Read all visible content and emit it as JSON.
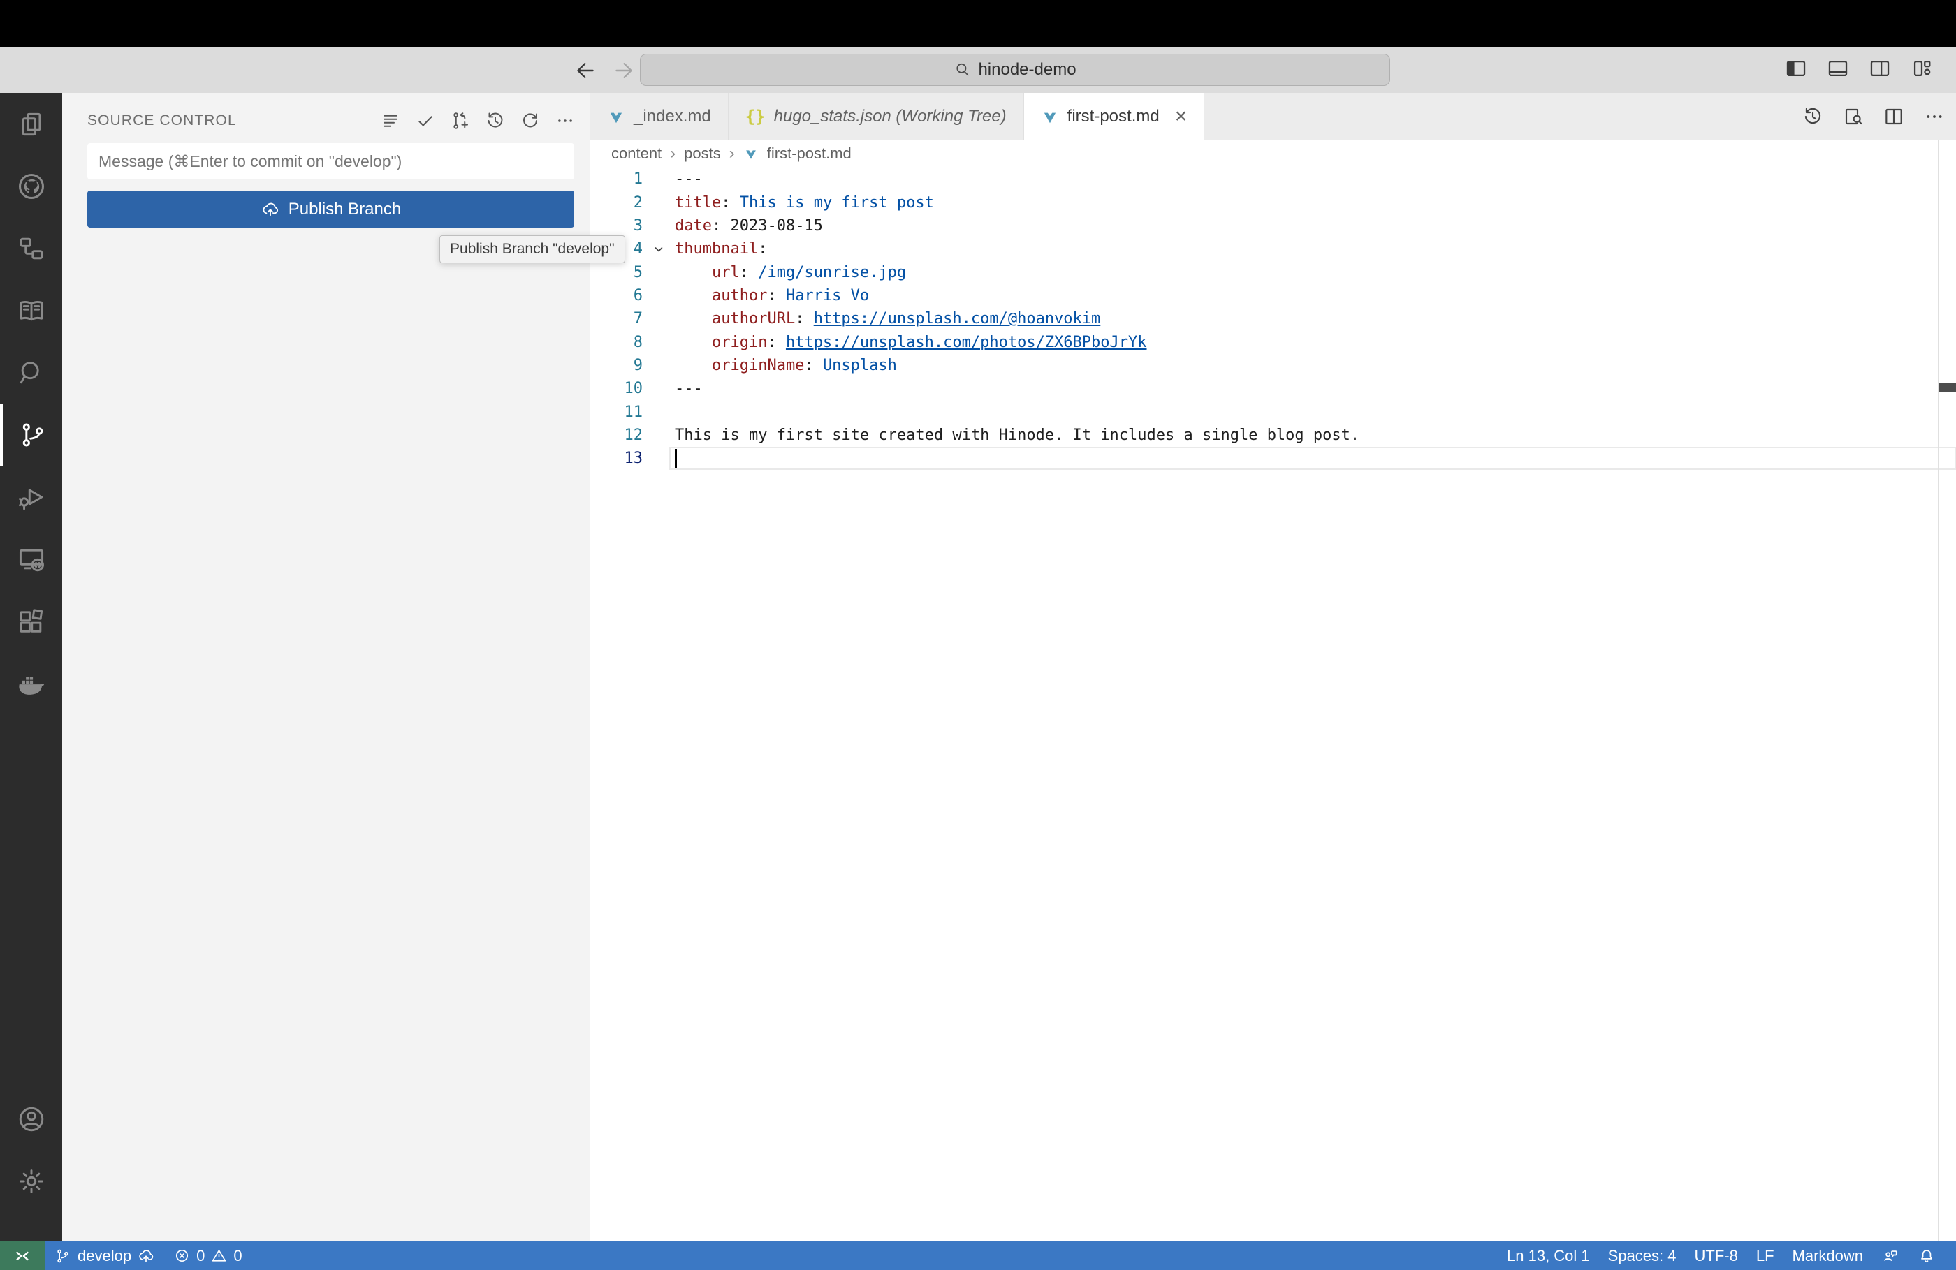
{
  "title_bar": {
    "search_value": "hinode-demo"
  },
  "source_control": {
    "header": "SOURCE CONTROL",
    "message_placeholder": "Message (⌘Enter to commit on \"develop\")",
    "publish_label": "Publish Branch",
    "tooltip": "Publish Branch \"develop\""
  },
  "tabs": {
    "tab1": "_index.md",
    "tab2": "hugo_stats.json (Working Tree)",
    "tab3": "first-post.md",
    "close_glyph": "×",
    "json_glyph": "{}"
  },
  "breadcrumbs": {
    "item1": "content",
    "item2": "posts",
    "item3": "first-post.md",
    "sep": "›"
  },
  "editor": {
    "lines": [
      {
        "num": "1",
        "tokens": [
          {
            "t": "---"
          }
        ]
      },
      {
        "num": "2",
        "tokens": [
          {
            "t": "title"
          },
          {
            "t": ": "
          },
          {
            "t": "This is my first post"
          }
        ]
      },
      {
        "num": "3",
        "tokens": [
          {
            "t": "date"
          },
          {
            "t": ": 2023-08-15"
          }
        ]
      },
      {
        "num": "4",
        "tokens": [
          {
            "t": "thumbnail"
          },
          {
            "t": ":"
          }
        ]
      },
      {
        "num": "5",
        "tokens": [
          {
            "t": "    url"
          },
          {
            "t": ": "
          },
          {
            "t": "/img/sunrise.jpg"
          }
        ]
      },
      {
        "num": "6",
        "tokens": [
          {
            "t": "    author"
          },
          {
            "t": ": "
          },
          {
            "t": "Harris Vo"
          }
        ]
      },
      {
        "num": "7",
        "tokens": [
          {
            "t": "    authorURL"
          },
          {
            "t": ": "
          },
          {
            "t": "https://unsplash.com/@hoanvokim"
          }
        ]
      },
      {
        "num": "8",
        "tokens": [
          {
            "t": "    origin"
          },
          {
            "t": ": "
          },
          {
            "t": "https://unsplash.com/photos/ZX6BPboJrYk"
          }
        ]
      },
      {
        "num": "9",
        "tokens": [
          {
            "t": "    originName"
          },
          {
            "t": ": "
          },
          {
            "t": "Unsplash"
          }
        ]
      },
      {
        "num": "10",
        "tokens": [
          {
            "t": "---"
          }
        ]
      },
      {
        "num": "11",
        "tokens": []
      },
      {
        "num": "12",
        "tokens": [
          {
            "t": "This is my first site created with Hinode. It includes a single blog post."
          }
        ]
      },
      {
        "num": "13",
        "tokens": []
      }
    ]
  },
  "status_bar": {
    "branch": "develop",
    "errors": "0",
    "warnings": "0",
    "line_col": "Ln 13, Col 1",
    "spaces": "Spaces: 4",
    "encoding": "UTF-8",
    "eol": "LF",
    "language": "Markdown"
  },
  "colors": {
    "accent_button": "#2d64a8",
    "status_bar_blue": "#3b78c4",
    "remote_green": "#3d7a5c",
    "markdown_icon_blue": "#519aba",
    "json_icon_yellow": "#cbcb41",
    "yaml_key": "#8f1f1f",
    "yaml_string_blue": "#0451a5",
    "line_number": "#237893",
    "activity_bar": "#2c2c2c",
    "sidebar_bg": "#f3f3f3",
    "titlebar_bg": "#dcdcdc"
  }
}
